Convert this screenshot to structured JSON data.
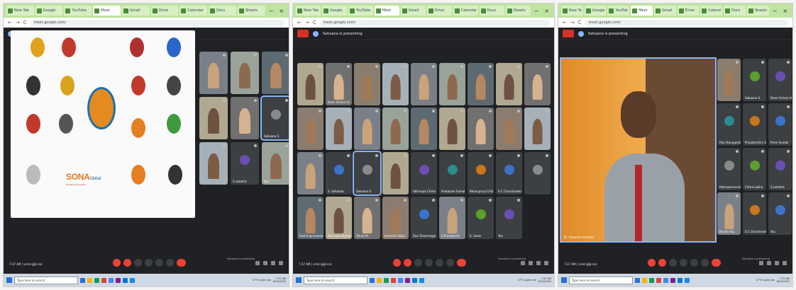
{
  "browser": {
    "tab_titles": [
      "New Tab",
      "Google",
      "YouTube",
      "Meet",
      "Gmail",
      "Drive",
      "Calendar",
      "Docs",
      "Sheets"
    ],
    "address": "meet.google.com/",
    "nav_back": "←",
    "nav_forward": "→",
    "nav_reload": "C",
    "minimize": "−",
    "close": "×"
  },
  "meeting": {
    "title": "Sahaana is presenting",
    "time_code": "7:37 AM",
    "code": "vmd-rgjb-nzs",
    "presenting_note": "Sahaana is presenting"
  },
  "panel1": {
    "slide": {
      "sona_text": "SONA",
      "sona_suffix": "Global",
      "sona_tagline": "Enabling Education"
    },
    "tiles": [
      {
        "name": ""
      },
      {
        "name": ""
      },
      {
        "name": ""
      },
      {
        "name": ""
      },
      {
        "name": ""
      },
      {
        "name": "Sahaana S"
      },
      {
        "name": ""
      },
      {
        "name": "S Lakshmi"
      },
      {
        "name": "You"
      }
    ]
  },
  "panel2": {
    "tiles": [
      "",
      "Dean School of...",
      "",
      "",
      "",
      "",
      "",
      "",
      "",
      "",
      "",
      "",
      "",
      "",
      "",
      "",
      "",
      "",
      "",
      "S. Sahaana",
      "Sahaana S",
      "",
      "Abhinaya Chitra",
      "Prakasam Sumathi",
      "Bhanupriya Chitra",
      "S.C.Chandrasekar",
      "",
      "Rashmiprasannan",
      "Abhinaya Kumar",
      "Shruti M.",
      "Janendra Babu",
      "Ravi Shanmugam",
      "S.Priyadarshi",
      "S. Sarav",
      "You"
    ]
  },
  "panel3": {
    "speaker_name": "Dr. Sreeram Krishnan",
    "side_tiles": [
      "",
      "Sahaana S",
      "Dean School of...",
      "Ravi Karuppiah",
      "Priyadarshini S",
      "Prem Sundar",
      "Ratnakumarvel",
      "Chitra Lekha",
      "S.Lakshmi",
      "Brinda Raj",
      "S.C.Chandrasekar",
      "You"
    ]
  },
  "taskbar": {
    "search_placeholder": "Type here to search",
    "weather": "27°C Light rain",
    "time": "7:37 AM",
    "date": "6/22/2022"
  },
  "colors": {
    "meet_bg": "#202124",
    "tile_bg": "#3c4043",
    "end_call": "#ea4335",
    "highlight": "#8ab4f8"
  }
}
